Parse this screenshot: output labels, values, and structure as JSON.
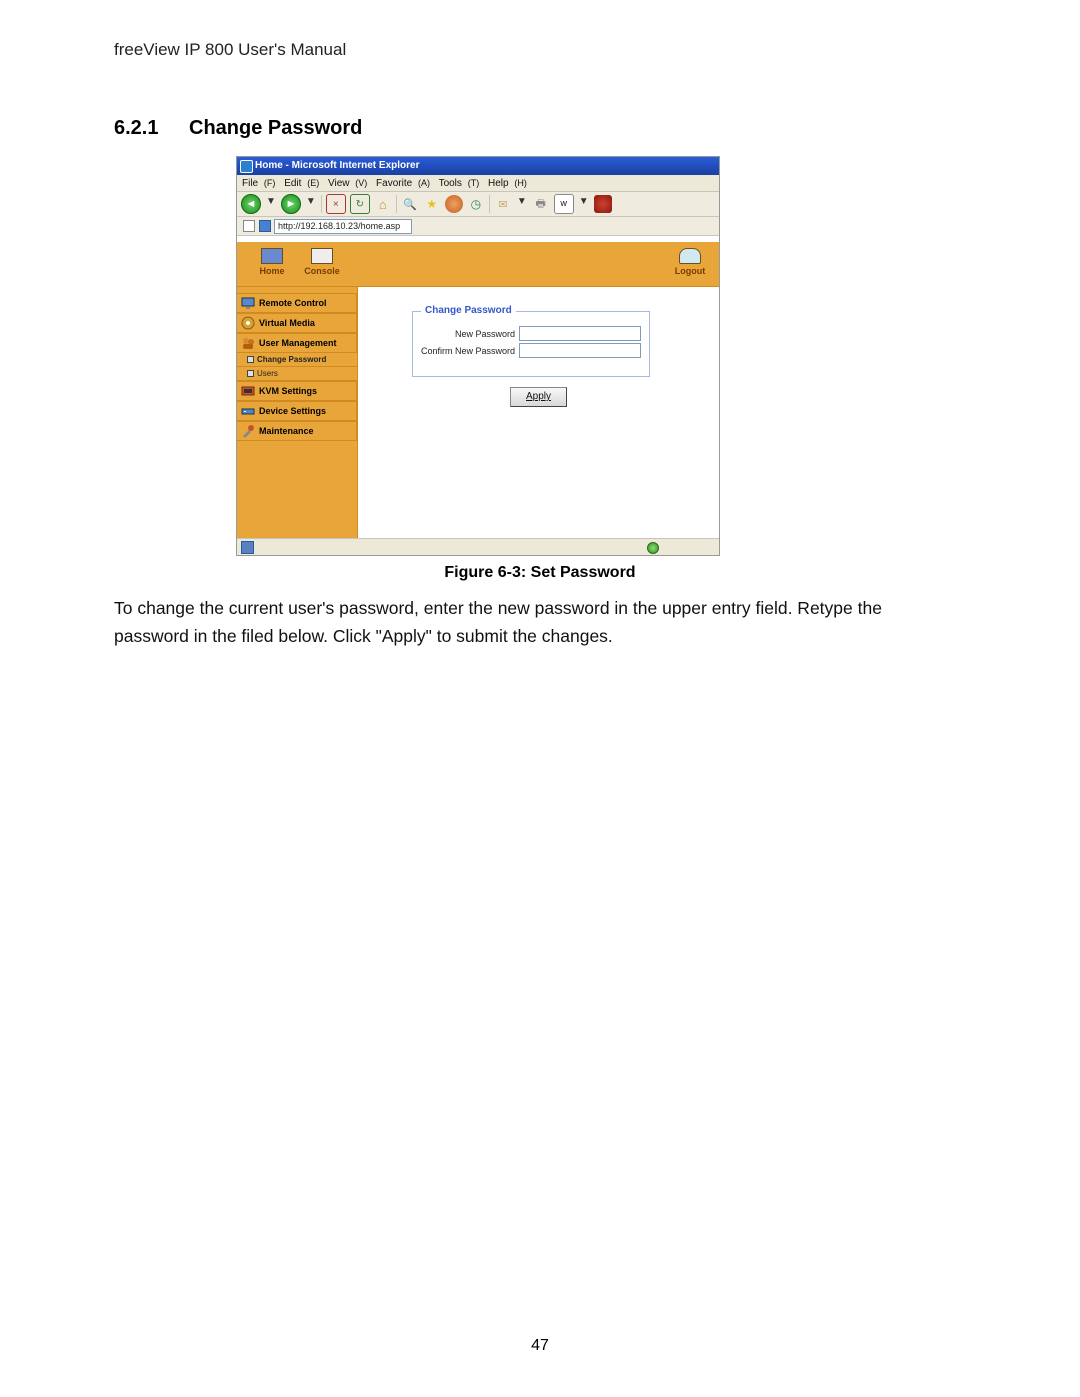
{
  "doc_header": "freeView IP 800 User's Manual",
  "section_number": "6.2.1",
  "section_title": "Change Password",
  "figure_caption": "Figure 6-3: Set Password",
  "body_text": "To change the current user's password, enter the new password in the upper entry field. Retype the password in the filed below. Click \"Apply\" to submit the changes.",
  "page_number": "47",
  "browser": {
    "title": "Home - Microsoft Internet Explorer",
    "menus": [
      "File",
      "Edit",
      "View",
      "Favorite",
      "Tools",
      "Help"
    ],
    "address_url": "http://192.168.10.23/home.asp"
  },
  "topnav": {
    "home": "Home",
    "console": "Console",
    "logout": "Logout"
  },
  "sidebar": {
    "remote_control": "Remote Control",
    "virtual_media": "Virtual Media",
    "user_management": "User Management",
    "change_password": "Change Password",
    "users": "Users",
    "kvm_settings": "KVM Settings",
    "device_settings": "Device Settings",
    "maintenance": "Maintenance"
  },
  "form": {
    "legend": "Change Password",
    "new_password_label": "New Password",
    "confirm_password_label": "Confirm New Password",
    "apply_label": "Apply"
  }
}
